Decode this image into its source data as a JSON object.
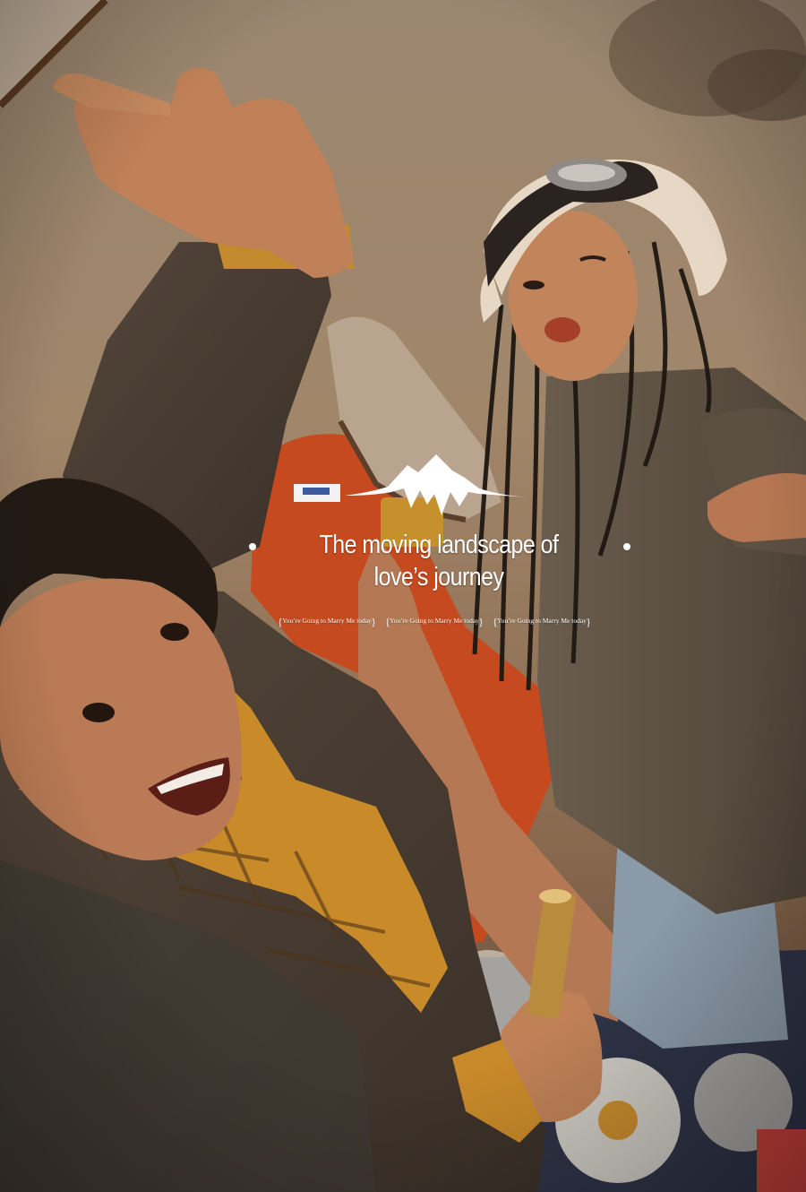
{
  "headline": "The moving landscape of love’s journey",
  "tagline_items": [
    {
      "text": "You’re Going to Marry Me today"
    },
    {
      "text": "You’re Going to Marry Me today"
    },
    {
      "text": "You’re Going to Marry Me today"
    }
  ],
  "patch_text": "",
  "colors": {
    "overlay_text": "#ffffff",
    "field": "#9c8062",
    "jacket": "#4a3d30",
    "scarf": "#c98a2a",
    "pants": "#c9471d",
    "skin": "#b77a52"
  }
}
